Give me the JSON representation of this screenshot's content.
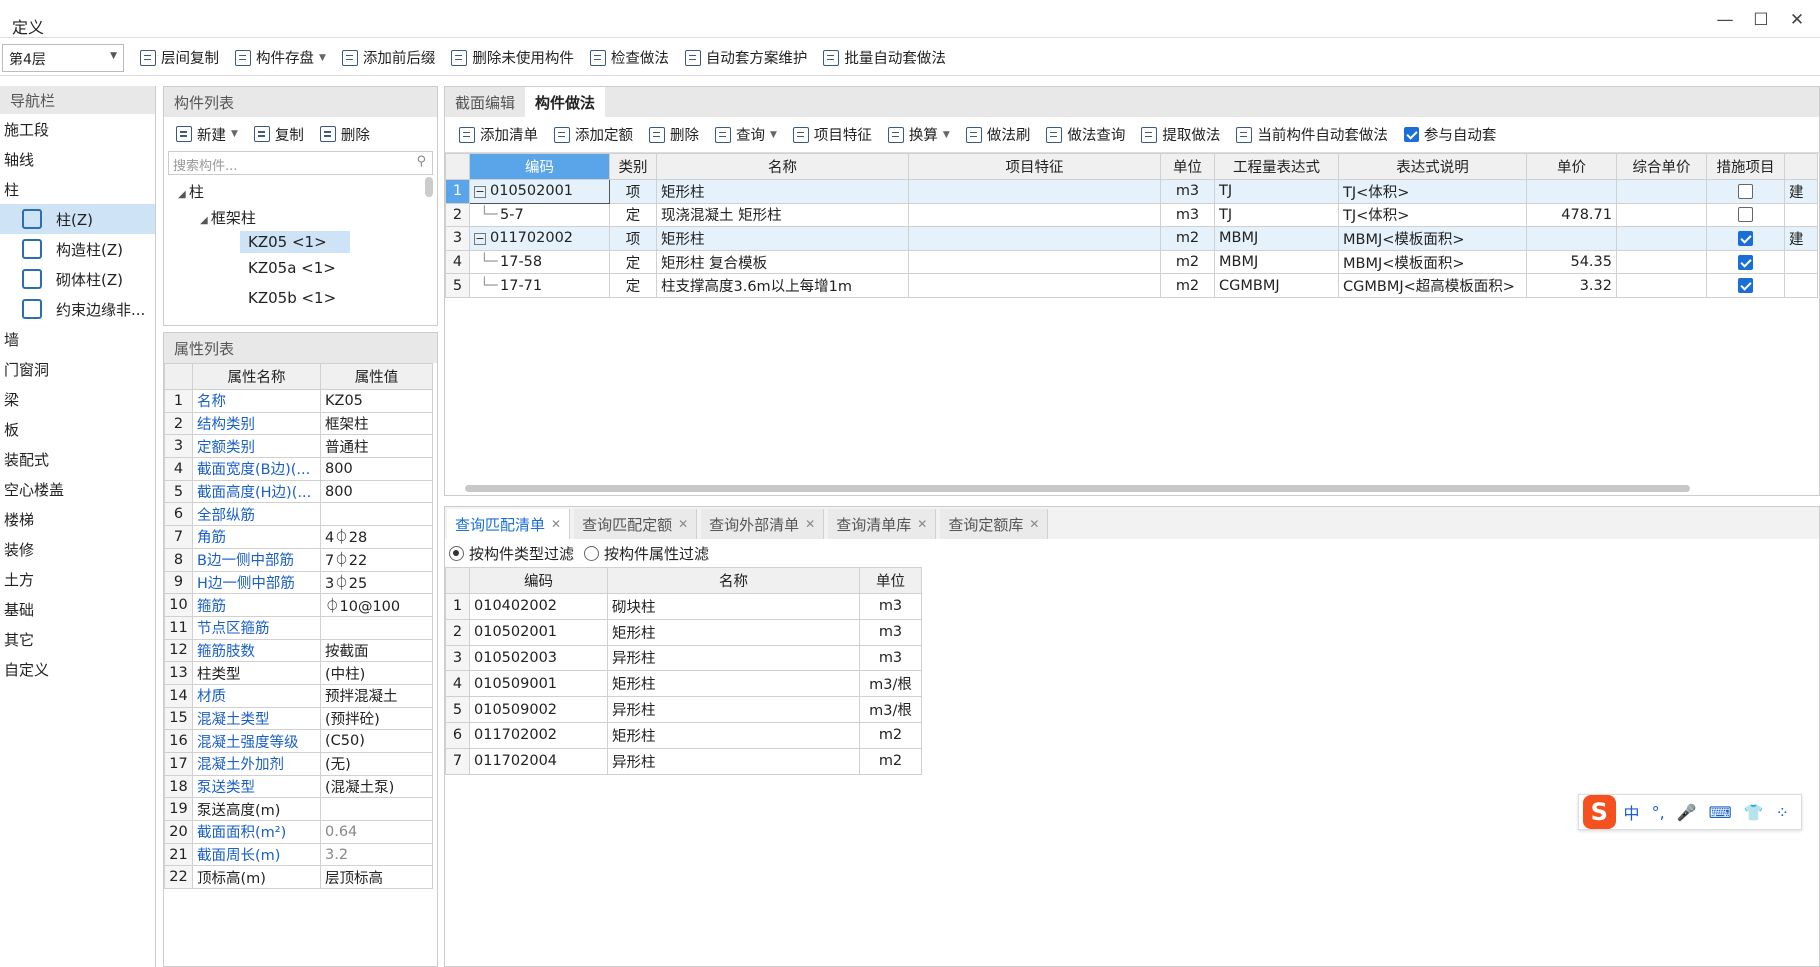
{
  "window": {
    "title": "定义"
  },
  "toolbar": {
    "floor": "第4层",
    "items": [
      "层间复制",
      "构件存盘",
      "添加前后缀",
      "删除未使用构件",
      "检查做法",
      "自动套方案维护",
      "批量自动套做法"
    ]
  },
  "nav": {
    "title": "导航栏",
    "items": [
      {
        "label": "施工段"
      },
      {
        "label": "轴线"
      },
      {
        "label": "柱"
      },
      {
        "label": "柱(Z)",
        "sub": true,
        "sel": true
      },
      {
        "label": "构造柱(Z)",
        "sub": true
      },
      {
        "label": "砌体柱(Z)",
        "sub": true
      },
      {
        "label": "约束边缘非...",
        "sub": true
      },
      {
        "label": "墙"
      },
      {
        "label": "门窗洞"
      },
      {
        "label": "梁"
      },
      {
        "label": "板"
      },
      {
        "label": "装配式"
      },
      {
        "label": "空心楼盖"
      },
      {
        "label": "楼梯"
      },
      {
        "label": "装修"
      },
      {
        "label": "土方"
      },
      {
        "label": "基础"
      },
      {
        "label": "其它"
      },
      {
        "label": "自定义"
      }
    ]
  },
  "components": {
    "title": "构件列表",
    "new": "新建",
    "copy": "复制",
    "delete": "删除",
    "search_placeholder": "搜索构件...",
    "tree": {
      "root": "柱",
      "group": "框架柱",
      "items": [
        "KZ05 <1>",
        "KZ05a <1>",
        "KZ05b <1>"
      ]
    }
  },
  "properties": {
    "title": "属性列表",
    "headers": [
      "属性名称",
      "属性值"
    ],
    "rows": [
      {
        "n": "1",
        "name": "名称",
        "val": "KZ05",
        "blue": true
      },
      {
        "n": "2",
        "name": "结构类别",
        "val": "框架柱",
        "blue": true
      },
      {
        "n": "3",
        "name": "定额类别",
        "val": "普通柱",
        "blue": true
      },
      {
        "n": "4",
        "name": "截面宽度(B边)(...",
        "val": "800",
        "blue": true
      },
      {
        "n": "5",
        "name": "截面高度(H边)(...",
        "val": "800",
        "blue": true
      },
      {
        "n": "6",
        "name": "全部纵筋",
        "val": "",
        "blue": true
      },
      {
        "n": "7",
        "name": "角筋",
        "val": "4⏀28",
        "blue": true
      },
      {
        "n": "8",
        "name": "B边一侧中部筋",
        "val": "7⏀22",
        "blue": true
      },
      {
        "n": "9",
        "name": "H边一侧中部筋",
        "val": "3⏀25",
        "blue": true
      },
      {
        "n": "10",
        "name": "箍筋",
        "val": "⏀10@100",
        "blue": true
      },
      {
        "n": "11",
        "name": "节点区箍筋",
        "val": "",
        "blue": true
      },
      {
        "n": "12",
        "name": "箍筋肢数",
        "val": "按截面",
        "blue": true
      },
      {
        "n": "13",
        "name": "柱类型",
        "val": "(中柱)",
        "blue": false
      },
      {
        "n": "14",
        "name": "材质",
        "val": "预拌混凝土",
        "blue": true
      },
      {
        "n": "15",
        "name": "混凝土类型",
        "val": "(预拌砼)",
        "blue": true
      },
      {
        "n": "16",
        "name": "混凝土强度等级",
        "val": "(C50)",
        "blue": true
      },
      {
        "n": "17",
        "name": "混凝土外加剂",
        "val": "(无)",
        "blue": true
      },
      {
        "n": "18",
        "name": "泵送类型",
        "val": "(混凝土泵)",
        "blue": true
      },
      {
        "n": "19",
        "name": "泵送高度(m)",
        "val": "",
        "blue": false
      },
      {
        "n": "20",
        "name": "截面面积(m²)",
        "val": "0.64",
        "blue": true,
        "gray": true
      },
      {
        "n": "21",
        "name": "截面周长(m)",
        "val": "3.2",
        "blue": true,
        "gray": true
      },
      {
        "n": "22",
        "name": "顶标高(m)",
        "val": "层顶标高",
        "blue": false
      }
    ]
  },
  "methods": {
    "tabs": [
      "截面编辑",
      "构件做法"
    ],
    "toolbar": [
      "添加清单",
      "添加定额",
      "删除",
      "查询",
      "项目特征",
      "换算",
      "做法刷",
      "做法查询",
      "提取做法",
      "当前构件自动套做法"
    ],
    "auto_label": "参与自动套",
    "headers": [
      "编码",
      "类别",
      "名称",
      "项目特征",
      "单位",
      "工程量表达式",
      "表达式说明",
      "单价",
      "综合单价",
      "措施项目"
    ],
    "rows": [
      {
        "n": "1",
        "code": "010502001",
        "type": "项",
        "name": "矩形柱",
        "feat": "",
        "unit": "m3",
        "expr": "TJ",
        "desc": "TJ<体积>",
        "price": "",
        "comp": "",
        "measure": false,
        "extra": "建",
        "top": true
      },
      {
        "n": "2",
        "code": "5-7",
        "type": "定",
        "name": "现浇混凝土 矩形柱",
        "feat": "",
        "unit": "m3",
        "expr": "TJ",
        "desc": "TJ<体积>",
        "price": "478.71",
        "comp": "",
        "measure": false,
        "extra": "",
        "top": false
      },
      {
        "n": "3",
        "code": "011702002",
        "type": "项",
        "name": "矩形柱",
        "feat": "",
        "unit": "m2",
        "expr": "MBMJ",
        "desc": "MBMJ<模板面积>",
        "price": "",
        "comp": "",
        "measure": true,
        "extra": "建",
        "top": true
      },
      {
        "n": "4",
        "code": "17-58",
        "type": "定",
        "name": "矩形柱 复合模板",
        "feat": "",
        "unit": "m2",
        "expr": "MBMJ",
        "desc": "MBMJ<模板面积>",
        "price": "54.35",
        "comp": "",
        "measure": true,
        "extra": "",
        "top": false
      },
      {
        "n": "5",
        "code": "17-71",
        "type": "定",
        "name": "柱支撑高度3.6m以上每增1m",
        "feat": "",
        "unit": "m2",
        "expr": "CGMBMJ",
        "desc": "CGMBMJ<超高模板面积>",
        "price": "3.32",
        "comp": "",
        "measure": true,
        "extra": "",
        "top": false
      }
    ]
  },
  "query": {
    "tabs": [
      "查询匹配清单",
      "查询匹配定额",
      "查询外部清单",
      "查询清单库",
      "查询定额库"
    ],
    "filters": [
      "按构件类型过滤",
      "按构件属性过滤"
    ],
    "headers": [
      "编码",
      "名称",
      "单位"
    ],
    "rows": [
      {
        "n": "1",
        "code": "010402002",
        "name": "砌块柱",
        "unit": "m3"
      },
      {
        "n": "2",
        "code": "010502001",
        "name": "矩形柱",
        "unit": "m3"
      },
      {
        "n": "3",
        "code": "010502003",
        "name": "异形柱",
        "unit": "m3"
      },
      {
        "n": "4",
        "code": "010509001",
        "name": "矩形柱",
        "unit": "m3/根"
      },
      {
        "n": "5",
        "code": "010509002",
        "name": "异形柱",
        "unit": "m3/根"
      },
      {
        "n": "6",
        "code": "011702002",
        "name": "矩形柱",
        "unit": "m2"
      },
      {
        "n": "7",
        "code": "011702004",
        "name": "异形柱",
        "unit": "m2"
      }
    ]
  },
  "ime": {
    "logo": "S",
    "items": [
      "中",
      "°,",
      "🎤",
      "⌨",
      "👕",
      "⁘"
    ]
  }
}
